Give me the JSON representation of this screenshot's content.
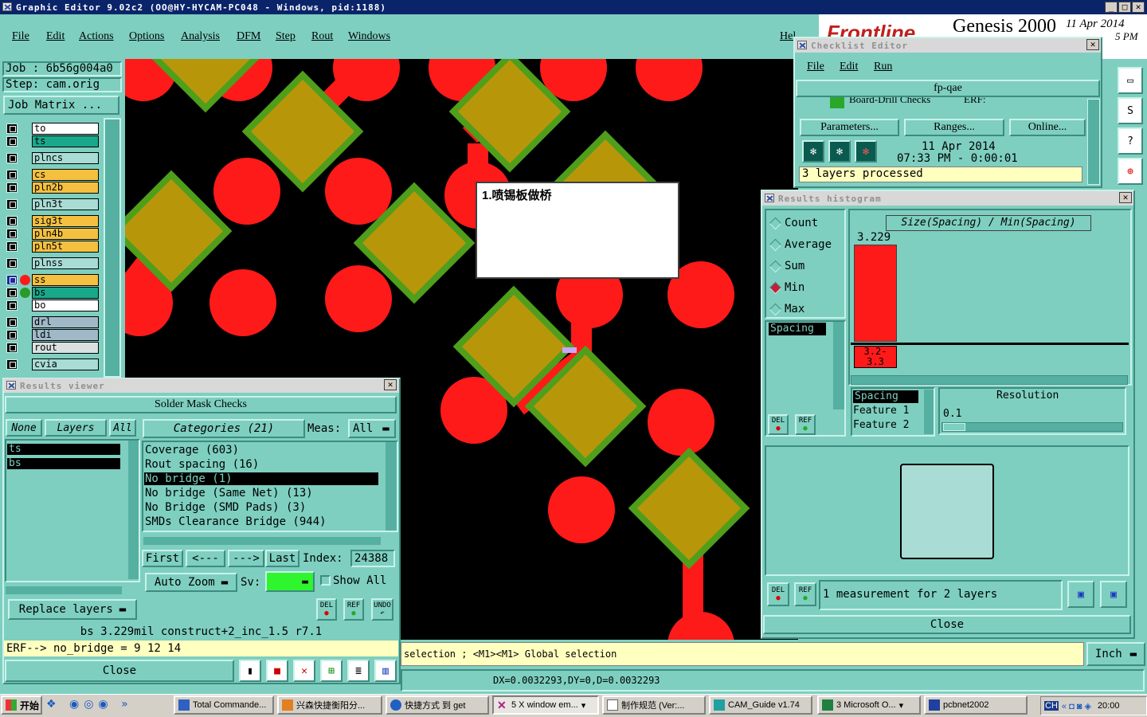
{
  "window": {
    "title": "Graphic Editor 9.02c2 (OO@HY-HYCAM-PC048 - Windows, pid:1188)"
  },
  "menu": [
    "File",
    "Edit",
    "Actions",
    "Options",
    "Analysis",
    "DFM",
    "Step",
    "Rout",
    "Windows"
  ],
  "help_label": "Hel",
  "brand": {
    "name": "Frontline",
    "product": "Genesis 2000",
    "date": "11 Apr 2014",
    "time_partial": "5 PM"
  },
  "job": {
    "job_line": "Job : 6b56g004a0",
    "step_line": "Step: cam.orig",
    "matrix_button": "Job Matrix ..."
  },
  "layers": [
    "to",
    "ts",
    "plncs",
    "cs",
    "pln2b",
    "pln3t",
    "sig3t",
    "pln4b",
    "pln5t",
    "plnss",
    "ss",
    "bs",
    "bo",
    "drl",
    "ldi",
    "rout",
    "cvia"
  ],
  "canvas": {
    "note": "1.喷锡板做桥"
  },
  "checklist": {
    "title": "Checklist Editor",
    "menu": [
      "File",
      "Edit",
      "Run"
    ],
    "name": "fp-qae",
    "row_text": "Board-Drill Checks",
    "row_erf": "ERF:",
    "buttons": [
      "Parameters...",
      "Ranges...",
      "Online..."
    ],
    "run_date": "11 Apr 2014",
    "run_time": "07:33 PM - 0:00:01",
    "status": "3 layers processed"
  },
  "histogram": {
    "title": "Results histogram",
    "modes": [
      "Count",
      "Average",
      "Sum",
      "Min",
      "Max"
    ],
    "selected_mode": "Min",
    "list_item": "Spacing",
    "graph_title": "Size(Spacing) / Min(Spacing)",
    "bar_value": "3.229",
    "bar_range": "3.2-\n3.3",
    "attr_list": [
      "Spacing",
      "Feature 1",
      "Feature 2"
    ],
    "resolution_label": "Resolution",
    "resolution_value": "0.1",
    "del": "DEL",
    "ref": "REF",
    "measurement": "1 measurement for 2 layers",
    "close": "Close"
  },
  "viewer": {
    "title": "Results viewer",
    "header": "Solder Mask Checks",
    "none": "None",
    "layers": "Layers",
    "all": "All",
    "layer_list": [
      "ts",
      "bs"
    ],
    "categories_label": "Categories (21)",
    "meas_label": "Meas:",
    "meas_value": "All",
    "categories": [
      "Coverage (603)",
      "Rout spacing (16)",
      "No bridge (1)",
      "No bridge (Same Net) (13)",
      "No Bridge (SMD Pads) (3)",
      "SMDs Clearance Bridge (944)"
    ],
    "selected_category": "No bridge (1)",
    "nav": [
      "First",
      "<---",
      "--->",
      "Last"
    ],
    "index_label": "Index:",
    "index_value": "24388",
    "auto_zoom": "Auto Zoom",
    "sv_label": "Sv:",
    "show_all": "Show All",
    "replace_layers": "Replace layers",
    "del": "DEL",
    "ref": "REF",
    "undo": "UNDO",
    "close": "Close"
  },
  "status": {
    "measure": "bs 3.229mil  construct+2_inc_1.5  r7.1",
    "erf": "ERF--> no_bridge = 9 12 14",
    "prompt": "selection ; <M1><M1> Global selection",
    "units": "Inch",
    "coords": "DX=0.0032293,DY=0,D=0.0032293"
  },
  "taskbar": {
    "start": "开始",
    "items": [
      "Total Commande...",
      "兴森快捷衡阳分...",
      "快捷方式 到 get",
      "5 X window em...",
      "制作规范 (Ver:...",
      "CAM_Guide v1.74",
      "3 Microsoft O...",
      "pcbnet2002"
    ],
    "tray_text": "CH",
    "clock": "20:00"
  },
  "colors": {
    "pad": "#ff1a1a",
    "smd": "#b8960a",
    "smd_border": "#4f9e1c",
    "canvas": "#000000",
    "ui": "#7ecfc0"
  }
}
